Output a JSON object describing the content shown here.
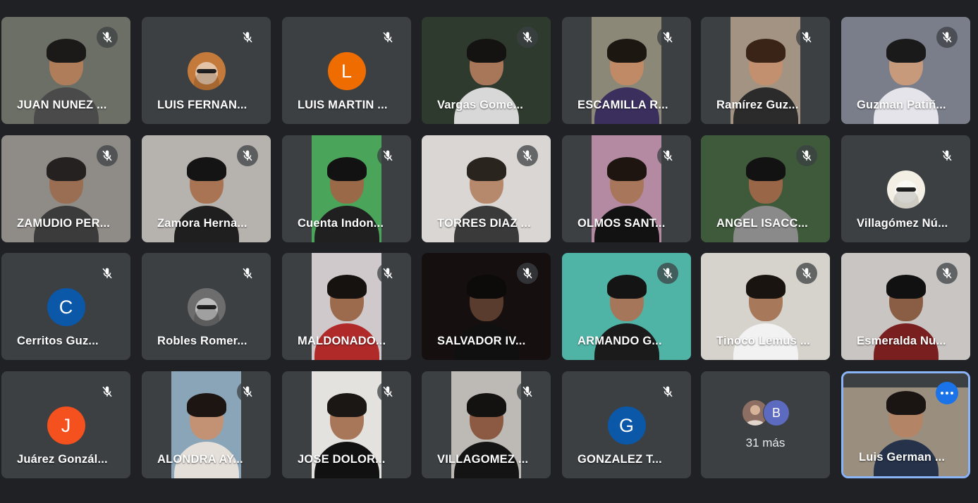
{
  "participants": [
    {
      "id": "p1",
      "name": "JUAN NUNEZ ...",
      "type": "video",
      "bg": "#6b6f66",
      "skin": "#b07d5a",
      "hair": "#1c1a18",
      "shirt": "#4a4a4a",
      "mic_icon": "mic-off-icon"
    },
    {
      "id": "p2",
      "name": "LUIS FERNAN...",
      "type": "avatar-img",
      "avatar_bg": "#c47a3a",
      "avatar_icon": "cat-sunglasses-avatar",
      "mic_icon": "mic-off-icon"
    },
    {
      "id": "p3",
      "name": "LUIS MARTIN ...",
      "type": "avatar-letter",
      "letter": "L",
      "avatar_bg": "#ef6c00",
      "mic_icon": "mic-off-icon"
    },
    {
      "id": "p4",
      "name": "Vargas Gome...",
      "type": "video",
      "bg": "#2f3a2f",
      "skin": "#a8775a",
      "hair": "#151311",
      "shirt": "#d8d8d8",
      "mic_icon": "mic-off-icon"
    },
    {
      "id": "p5",
      "name": "ESCAMILLA R...",
      "type": "video-pillar",
      "bg": "#8c8878",
      "skin": "#c08a66",
      "hair": "#1d1712",
      "shirt": "#3b2f5e",
      "mic_icon": "mic-off-icon"
    },
    {
      "id": "p6",
      "name": "Ramírez Guz...",
      "type": "video-pillar",
      "bg": "#a29383",
      "skin": "#c2906e",
      "hair": "#3a2418",
      "shirt": "#2b2b2b",
      "mic_icon": "mic-off-icon"
    },
    {
      "id": "p7",
      "name": "Guzman Patiñ...",
      "type": "video",
      "bg": "#7a7e8a",
      "skin": "#c79a7c",
      "hair": "#1a1a1a",
      "shirt": "#e4e4ea",
      "mic_icon": "mic-off-icon"
    },
    {
      "id": "p8",
      "name": "ZAMUDIO PER...",
      "type": "video",
      "bg": "#8f8c87",
      "skin": "#9a6e52",
      "hair": "#252120",
      "shirt": "#3b3b3b",
      "mic_icon": "mic-off-icon"
    },
    {
      "id": "p9",
      "name": "Zamora Herna...",
      "type": "video",
      "bg": "#b6b2ae",
      "skin": "#a87454",
      "hair": "#141414",
      "shirt": "#1f1f1f",
      "mic_icon": "mic-off-icon"
    },
    {
      "id": "p10",
      "name": "Cuenta Indon...",
      "type": "video-pillar",
      "bg": "#4aa55a",
      "skin": "#9a6a48",
      "hair": "#121212",
      "shirt": "#202020",
      "mic_icon": "mic-off-icon"
    },
    {
      "id": "p11",
      "name": "TORRES DIAZ ...",
      "type": "video",
      "bg": "#d9d6d3",
      "skin": "#b7896c",
      "hair": "#2a241f",
      "shirt": "#3a3a3a",
      "mic_icon": "mic-off-icon"
    },
    {
      "id": "p12",
      "name": "OLMOS SANT...",
      "type": "video-pillar",
      "bg": "#b48aa2",
      "skin": "#a8765a",
      "hair": "#1e1510",
      "shirt": "#121212",
      "mic_icon": "mic-off-icon"
    },
    {
      "id": "p13",
      "name": "ANGEL ISACC...",
      "type": "video",
      "bg": "#3e5a3a",
      "skin": "#9a6648",
      "hair": "#121212",
      "shirt": "#8a8a8a",
      "mic_icon": "mic-off-icon"
    },
    {
      "id": "p14",
      "name": "Villagómez Nú...",
      "type": "avatar-img",
      "avatar_bg": "#f3efe4",
      "avatar_icon": "anime-character-avatar",
      "mic_icon": "mic-off-icon"
    },
    {
      "id": "p15",
      "name": "Cerritos Guz...",
      "type": "avatar-letter",
      "letter": "C",
      "avatar_bg": "#0b57a8",
      "mic_icon": "mic-off-icon"
    },
    {
      "id": "p16",
      "name": "Robles Romer...",
      "type": "avatar-img",
      "avatar_bg": "#6d6d6d",
      "avatar_icon": "bw-photo-avatar",
      "mic_icon": "mic-off-icon"
    },
    {
      "id": "p17",
      "name": "MALDONADO...",
      "type": "video-pillar",
      "bg": "#cfc9cc",
      "skin": "#9c6a4c",
      "hair": "#161210",
      "shirt": "#b02a2a",
      "mic_icon": "mic-off-icon"
    },
    {
      "id": "p18",
      "name": "SALVADOR IV...",
      "type": "video",
      "bg": "#160f10",
      "skin": "#5a3c2e",
      "hair": "#0d0a0a",
      "shirt": "#101010",
      "mic_icon": "mic-off-icon"
    },
    {
      "id": "p19",
      "name": "ARMANDO G...",
      "type": "video",
      "bg": "#4fb3a6",
      "skin": "#a6765a",
      "hair": "#141414",
      "shirt": "#1b1b1b",
      "mic_icon": "mic-off-icon"
    },
    {
      "id": "p20",
      "name": "Tinoco Lemus ...",
      "type": "video",
      "bg": "#d6d2cc",
      "skin": "#a8785a",
      "hair": "#1a1410",
      "shirt": "#f2f2f2",
      "mic_icon": "mic-off-icon"
    },
    {
      "id": "p21",
      "name": "Esmeralda Nu...",
      "type": "video",
      "bg": "#c9c5c2",
      "skin": "#8a5e44",
      "hair": "#111111",
      "shirt": "#7a1f1f",
      "mic_icon": "mic-off-icon"
    },
    {
      "id": "p22",
      "name": "Juárez Gonzál...",
      "type": "avatar-letter",
      "letter": "J",
      "avatar_bg": "#f4511e",
      "mic_icon": "mic-off-icon"
    },
    {
      "id": "p23",
      "name": "ALONDRA AY...",
      "type": "video-pillar",
      "bg": "#8aa4b8",
      "skin": "#c39274",
      "hair": "#1c1512",
      "shirt": "#e5dfd9",
      "mic_icon": "mic-off-icon"
    },
    {
      "id": "p24",
      "name": "JOSE DOLOR...",
      "type": "video-pillar",
      "bg": "#e4e2df",
      "skin": "#a87658",
      "hair": "#1a1714",
      "shirt": "#111111",
      "mic_icon": "mic-off-icon"
    },
    {
      "id": "p25",
      "name": "VILLAGOMEZ ...",
      "type": "video-pillar",
      "bg": "#bdbab6",
      "skin": "#8c5a42",
      "hair": "#141210",
      "shirt": "#141414",
      "mic_icon": "mic-off-icon"
    },
    {
      "id": "p26",
      "name": "GONZALEZ T...",
      "type": "avatar-letter",
      "letter": "G",
      "avatar_bg": "#0b57a8",
      "mic_icon": "mic-off-icon"
    },
    {
      "id": "p27",
      "name": "",
      "type": "more",
      "more_label": "31 más",
      "more_letter": "B"
    },
    {
      "id": "p28",
      "name": "Luis German ...",
      "type": "self",
      "bg": "#9a8f7f",
      "skin": "#b38465",
      "hair": "#1a1412",
      "shirt": "#25324a",
      "more_icon": "more-options-icon"
    }
  ],
  "colors": {
    "page_bg": "#202124",
    "tile_bg": "#3c4043",
    "self_border": "#8ab4f8",
    "accent": "#1a73e8"
  }
}
